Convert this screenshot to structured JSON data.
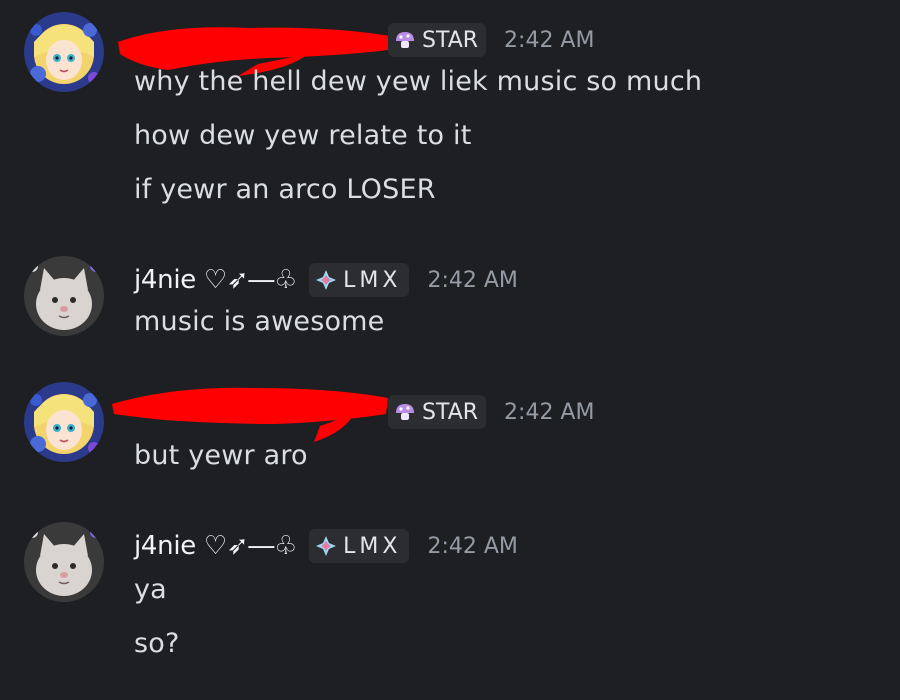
{
  "messages": [
    {
      "author": "",
      "author_redacted": true,
      "tag": {
        "label": "STAR",
        "icon": "mushroom-icon",
        "icon_color": "#b98ce6"
      },
      "time": "2:42 AM",
      "lines": [
        "why the hell dew yew liek music so much",
        "how dew yew relate to it",
        "if yewr an arco LOSER"
      ]
    },
    {
      "author": "j4nie ♡➶―♧",
      "author_redacted": false,
      "tag": {
        "label": "LMX",
        "icon": "diamond-sparkle-icon",
        "icon_color": "#e57aa6"
      },
      "time": "2:42 AM",
      "lines": [
        "music is awesome"
      ]
    },
    {
      "author": "",
      "author_redacted": true,
      "tag": {
        "label": "STAR",
        "icon": "mushroom-icon",
        "icon_color": "#b98ce6"
      },
      "time": "2:42 AM",
      "lines": [
        "but yewr aro"
      ]
    },
    {
      "author": "j4nie ♡➶―♧",
      "author_redacted": false,
      "tag": {
        "label": "LMX",
        "icon": "diamond-sparkle-icon",
        "icon_color": "#e57aa6"
      },
      "time": "2:42 AM",
      "lines": [
        "ya",
        "so?"
      ]
    }
  ],
  "colors": {
    "background": "#1e1f22",
    "text": "#dbdee1",
    "timestamp": "#949ba4",
    "tag_background": "#2b2d31",
    "redaction": "#ff0000"
  }
}
